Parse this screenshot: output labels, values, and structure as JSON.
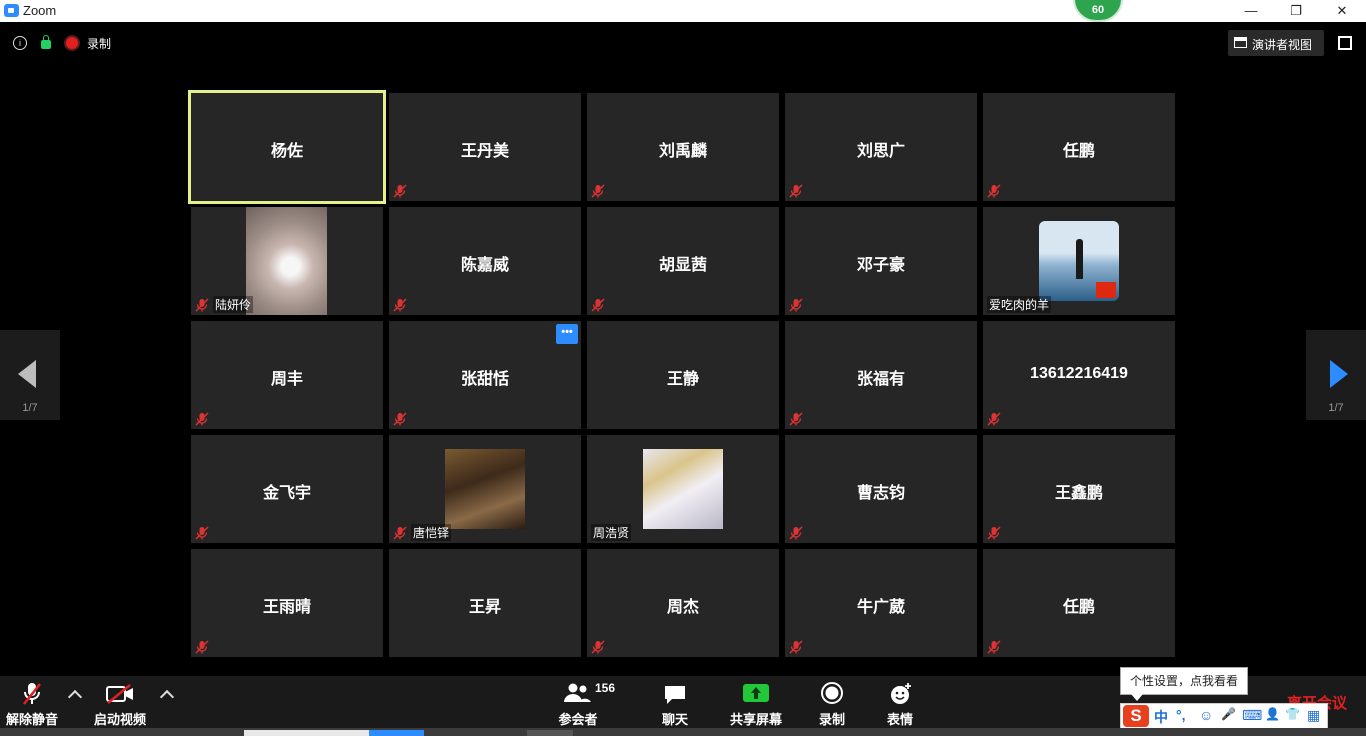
{
  "window": {
    "title": "Zoom",
    "minimize": "—",
    "maximize": "❐",
    "close": "✕",
    "badge": "60"
  },
  "topbar": {
    "info": "i",
    "recording_label": "录制",
    "speaker_view_label": "演讲者视图"
  },
  "pager": {
    "page_left": "1/7",
    "page_right": "1/7"
  },
  "tiles": [
    {
      "name": "杨佐",
      "style": "center",
      "active": true,
      "muted": false
    },
    {
      "name": "王丹美",
      "style": "center",
      "muted": true
    },
    {
      "name": "刘禹麟",
      "style": "center",
      "muted": true
    },
    {
      "name": "刘思广",
      "style": "center",
      "muted": true
    },
    {
      "name": "任鹏",
      "style": "center",
      "muted": true
    },
    {
      "name": "陆妍伶",
      "style": "video",
      "muted": true
    },
    {
      "name": "陈嘉威",
      "style": "center",
      "muted": true
    },
    {
      "name": "胡显茜",
      "style": "center",
      "muted": true
    },
    {
      "name": "邓子豪",
      "style": "center",
      "muted": true
    },
    {
      "name": "爱吃肉的羊",
      "style": "avatar",
      "muted": false
    },
    {
      "name": "周丰",
      "style": "center",
      "muted": true
    },
    {
      "name": "张甜恬",
      "style": "center",
      "muted": true,
      "more": "•••"
    },
    {
      "name": "王静",
      "style": "center",
      "muted": false
    },
    {
      "name": "张福有",
      "style": "center",
      "muted": true
    },
    {
      "name": "13612216419",
      "style": "center",
      "muted": true
    },
    {
      "name": "金飞宇",
      "style": "center",
      "muted": true
    },
    {
      "name": "唐恺铎",
      "style": "photo",
      "muted": true
    },
    {
      "name": "周浩贤",
      "style": "anime",
      "muted": false
    },
    {
      "name": "曹志钧",
      "style": "center",
      "muted": true
    },
    {
      "name": "王鑫鹏",
      "style": "center",
      "muted": true
    },
    {
      "name": "王雨晴",
      "style": "center",
      "muted": true
    },
    {
      "name": "王昇",
      "style": "center",
      "muted": false
    },
    {
      "name": "周杰",
      "style": "center",
      "muted": true
    },
    {
      "name": "牛广葳",
      "style": "center",
      "muted": true
    },
    {
      "name": "任鹏",
      "style": "center",
      "muted": true
    }
  ],
  "toolbar": {
    "unmute": "解除静音",
    "start_video": "启动视频",
    "participants": "参会者",
    "participants_count": "156",
    "chat": "聊天",
    "share_screen": "共享屏幕",
    "record": "录制",
    "reactions": "表情",
    "end_meeting": "离开会议"
  },
  "ime": {
    "tooltip": "个性设置，点我看看",
    "logo": "S",
    "mode": "中",
    "punct": "°,",
    "items": [
      "☺",
      "🎤",
      "⌨",
      "👤",
      "👕",
      "▦"
    ]
  },
  "colors": {
    "accent": "#2d8cff",
    "active_border": "#e6f08a",
    "tile_bg": "#262626",
    "muted_red": "#e02020",
    "share_green": "#23c73a"
  }
}
